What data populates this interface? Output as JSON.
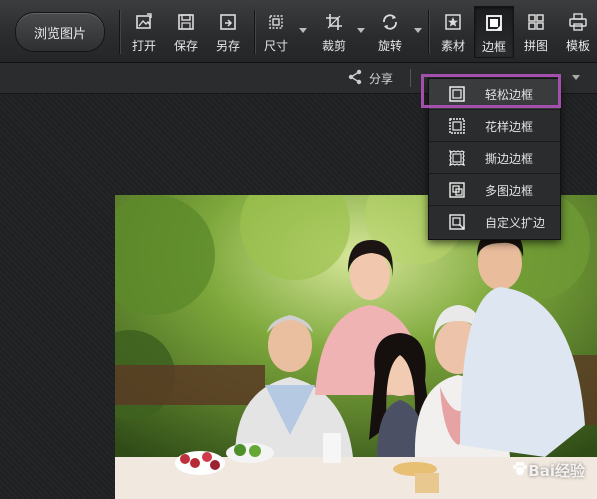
{
  "toolbar": {
    "browse_label": "浏览图片",
    "tools": [
      {
        "label": "打开",
        "icon": "open-image-icon"
      },
      {
        "label": "保存",
        "icon": "save-icon"
      },
      {
        "label": "另存",
        "icon": "save-as-icon"
      },
      {
        "label": "尺寸",
        "icon": "resize-icon"
      },
      {
        "label": "裁剪",
        "icon": "crop-icon"
      },
      {
        "label": "旋转",
        "icon": "rotate-icon"
      },
      {
        "label": "素材",
        "icon": "material-star-icon"
      },
      {
        "label": "边框",
        "icon": "border-frame-icon"
      },
      {
        "label": "拼图",
        "icon": "collage-grid-icon"
      },
      {
        "label": "模板",
        "icon": "template-printer-icon"
      }
    ],
    "active_tool": "边框"
  },
  "subbar": {
    "share_label": "分享",
    "share_icon": "share-icon"
  },
  "border_menu": {
    "items": [
      {
        "label": "轻松边框",
        "icon": "simple-frame-icon"
      },
      {
        "label": "花样边框",
        "icon": "pattern-frame-icon"
      },
      {
        "label": "撕边边框",
        "icon": "torn-edge-frame-icon"
      },
      {
        "label": "多图边框",
        "icon": "multi-image-frame-icon"
      },
      {
        "label": "自定义扩边",
        "icon": "custom-extend-frame-icon"
      }
    ],
    "selected": "轻松边框",
    "highlight_color": "#a24fae"
  },
  "photo": {
    "description_icon": "family-photo",
    "watermark": "Bai经验"
  },
  "colors": {
    "toolbar_bg": "#2f3032",
    "canvas_bg": "#1f2022",
    "highlight": "#a24fae"
  }
}
